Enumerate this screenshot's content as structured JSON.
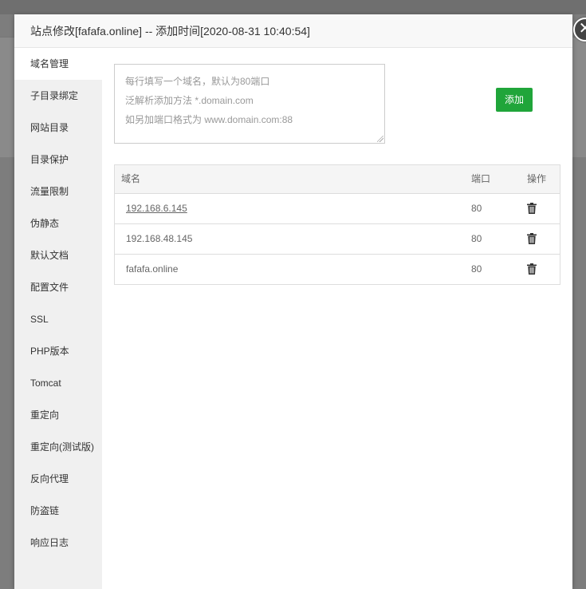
{
  "dialog": {
    "title": "站点修改[fafafa.online] -- 添加时间[2020-08-31 10:40:54]",
    "close_glyph": "✕"
  },
  "sidebar": {
    "items": [
      {
        "label": "域名管理",
        "active": true
      },
      {
        "label": "子目录绑定"
      },
      {
        "label": "网站目录"
      },
      {
        "label": "目录保护"
      },
      {
        "label": "流量限制"
      },
      {
        "label": "伪静态"
      },
      {
        "label": "默认文档"
      },
      {
        "label": "配置文件"
      },
      {
        "label": "SSL"
      },
      {
        "label": "PHP版本"
      },
      {
        "label": "Tomcat"
      },
      {
        "label": "重定向"
      },
      {
        "label": "重定向(测试版)"
      },
      {
        "label": "反向代理"
      },
      {
        "label": "防盗链"
      },
      {
        "label": "响应日志"
      }
    ]
  },
  "domain_input": {
    "placeholder_lines": [
      "每行填写一个域名，默认为80端口",
      "泛解析添加方法 *.domain.com",
      "如另加端口格式为 www.domain.com:88"
    ],
    "value": ""
  },
  "add_button": {
    "label": "添加",
    "color": "#20a53a"
  },
  "table": {
    "headers": {
      "domain": "域名",
      "port": "端口",
      "action": "操作"
    },
    "rows": [
      {
        "domain": "192.168.6.145",
        "port": "80",
        "link": true,
        "action_icon": "trash-icon"
      },
      {
        "domain": "192.168.48.145",
        "port": "80",
        "link": false,
        "action_icon": "trash-icon"
      },
      {
        "domain": "fafafa.online",
        "port": "80",
        "link": false,
        "action_icon": "trash-icon"
      }
    ]
  }
}
